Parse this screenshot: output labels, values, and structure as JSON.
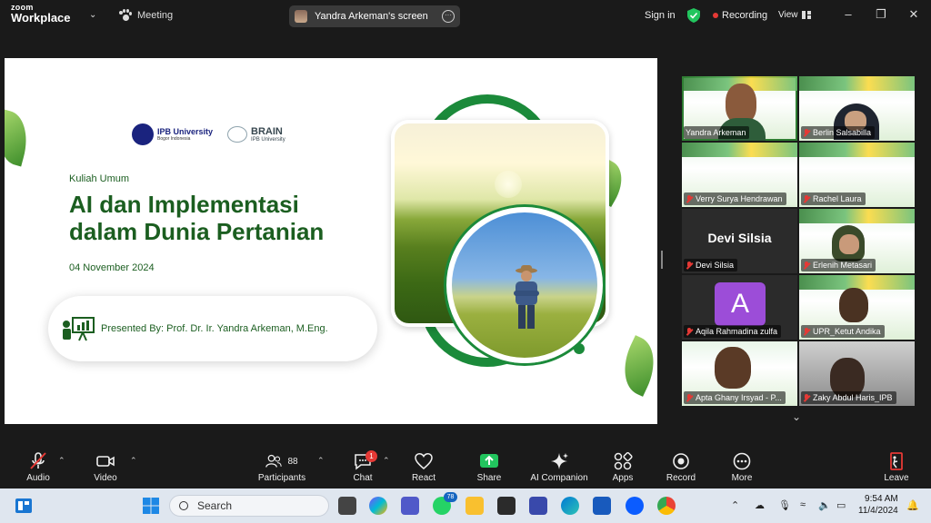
{
  "app": {
    "logo_top": "zoom",
    "logo_bottom": "Workplace",
    "meeting_label": "Meeting",
    "screen_share_label": "Yandra Arkeman's screen",
    "signin": "Sign in",
    "recording": "Recording",
    "view": "View"
  },
  "slide": {
    "ipb_name": "IPB University",
    "ipb_sub": "Bogor Indonesia",
    "brain_name": "BRAIN",
    "brain_sub": "IPB University",
    "kicker": "Kuliah Umum",
    "title_line1": "AI dan Implementasi",
    "title_line2": "dalam Dunia Pertanian",
    "date": "04 November 2024",
    "presenter": "Presented By: Prof. Dr. Ir. Yandra Arkeman, M.Eng."
  },
  "participants": [
    {
      "name": "Yandra Arkeman"
    },
    {
      "name": "Berlin Salsabilla"
    },
    {
      "name": "Verry Surya Hendrawan"
    },
    {
      "name": "Rachel Laura"
    },
    {
      "name": "Devi Silsia",
      "display": "Devi Silsia"
    },
    {
      "name": "Erlenih Metasari"
    },
    {
      "name": "Aqila Rahmadina zulfa",
      "initial": "A"
    },
    {
      "name": "UPR_Ketut Andika"
    },
    {
      "name": "Apta Ghany Irsyad - P..."
    },
    {
      "name": "Zaky Abdul Haris_IPB"
    }
  ],
  "toolbar": {
    "audio": "Audio",
    "video": "Video",
    "participants": "Participants",
    "participant_count": "88",
    "chat": "Chat",
    "chat_badge": "1",
    "react": "React",
    "share": "Share",
    "ai_companion": "AI Companion",
    "apps": "Apps",
    "record": "Record",
    "more": "More",
    "leave": "Leave"
  },
  "taskbar": {
    "search_placeholder": "Search",
    "whatsapp_badge": "78",
    "time": "9:54 AM",
    "date": "11/4/2024"
  },
  "colors": {
    "accent_green": "#1b5e20",
    "recording_red": "#e53935",
    "share_green": "#22c55e"
  }
}
